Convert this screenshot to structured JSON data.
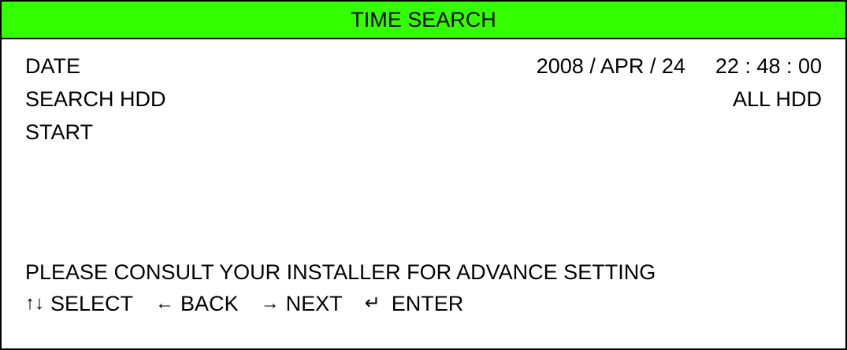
{
  "title": "TIME SEARCH",
  "colors": {
    "title_bar": "#33ff00",
    "background": "#ffffff",
    "text": "#000000"
  },
  "fields": {
    "date": {
      "label": "DATE",
      "date": "2008 / APR / 24",
      "time": "22 : 48 : 00"
    },
    "search_hdd": {
      "label": "SEARCH HDD",
      "value": "ALL HDD"
    },
    "start": {
      "label": "START"
    }
  },
  "note": "PLEASE CONSULT YOUR INSTALLER FOR ADVANCE SETTING",
  "hints": [
    {
      "icon": "up-down-arrows-icon",
      "glyph": "↑↓",
      "label": "SELECT"
    },
    {
      "icon": "left-arrow-icon",
      "glyph": "←",
      "label": "BACK"
    },
    {
      "icon": "right-arrow-icon",
      "glyph": "→",
      "label": "NEXT"
    },
    {
      "icon": "enter-icon",
      "glyph": "↵",
      "label": "ENTER"
    }
  ]
}
